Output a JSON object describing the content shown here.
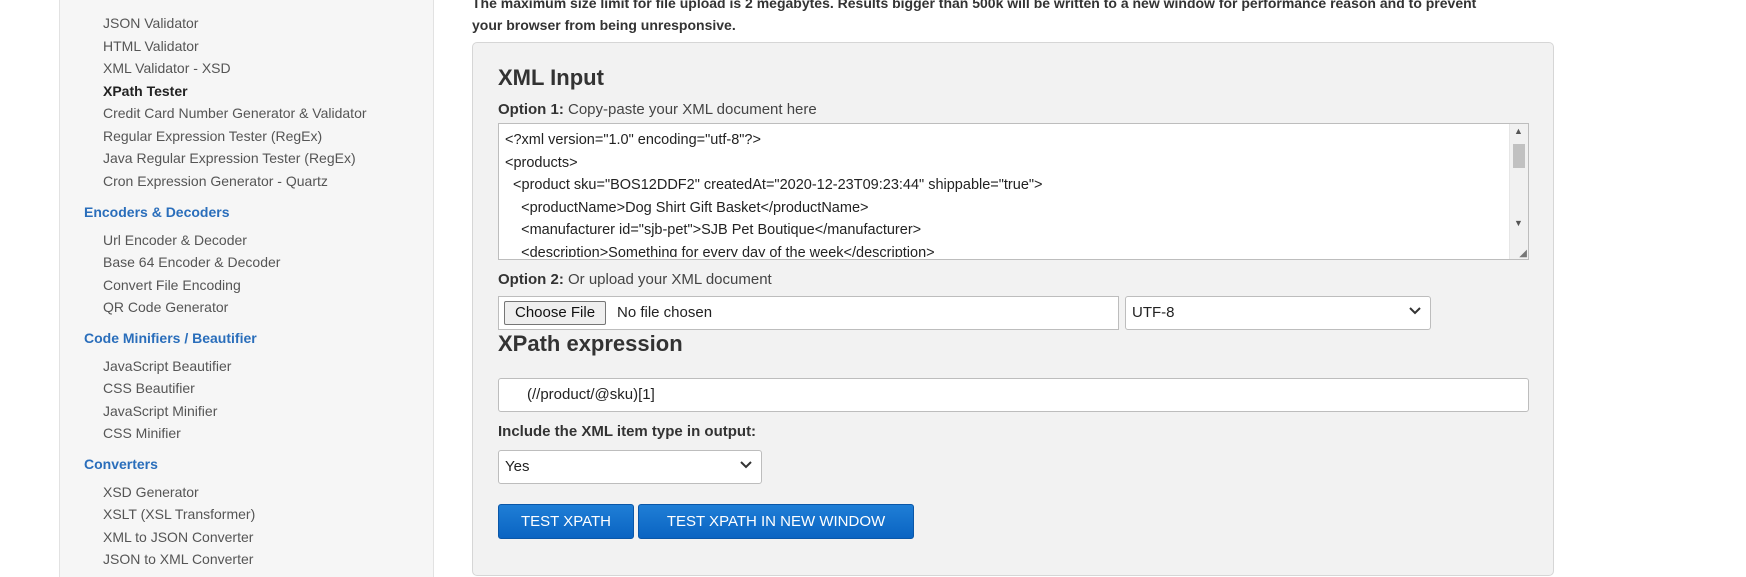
{
  "sidebar": {
    "validators": [
      "JSON Validator",
      "HTML Validator",
      "XML Validator - XSD",
      "XPath Tester",
      "Credit Card Number Generator & Validator",
      "Regular Expression Tester (RegEx)",
      "Java Regular Expression Tester (RegEx)",
      "Cron Expression Generator - Quartz"
    ],
    "encoders_title": "Encoders & Decoders",
    "encoders": [
      "Url Encoder & Decoder",
      "Base 64 Encoder & Decoder",
      "Convert File Encoding",
      "QR Code Generator"
    ],
    "minifiers_title": "Code Minifiers / Beautifier",
    "minifiers": [
      "JavaScript Beautifier",
      "CSS Beautifier",
      "JavaScript Minifier",
      "CSS Minifier"
    ],
    "converters_title": "Converters",
    "converters": [
      "XSD Generator",
      "XSLT (XSL Transformer)",
      "XML to JSON Converter",
      "JSON to XML Converter"
    ]
  },
  "notice": {
    "line1": "The maximum size limit for file upload is 2 megabytes. Results bigger than 500k will be written to a new window for performance reason and to prevent",
    "line2": "your browser from being unresponsive."
  },
  "panel": {
    "xml_input_title": "XML Input",
    "option1_label": "Option 1:",
    "option1_text": " Copy-paste your XML document here",
    "xml_code": "<?xml version=\"1.0\" encoding=\"utf-8\"?>\n<products>\n  <product sku=\"BOS12DDF2\" createdAt=\"2020-12-23T09:23:44\" shippable=\"true\">\n    <productName>Dog Shirt Gift Basket</productName>\n    <manufacturer id=\"sjb-pet\">SJB Pet Boutique</manufacturer>\n    <description>Something for every day of the week</description>",
    "option2_label": "Option 2:",
    "option2_text": " Or upload your XML document",
    "choose_file": "Choose File",
    "no_file": "No file chosen",
    "encoding": "UTF-8",
    "xpath_title": "XPath expression",
    "xpath_value": "(//product/@sku)[1]",
    "include_label": "Include the XML item type in output:",
    "include_value": "Yes",
    "test_button": "TEST XPATH",
    "test_new_window_button": "TEST XPATH IN NEW WINDOW"
  }
}
